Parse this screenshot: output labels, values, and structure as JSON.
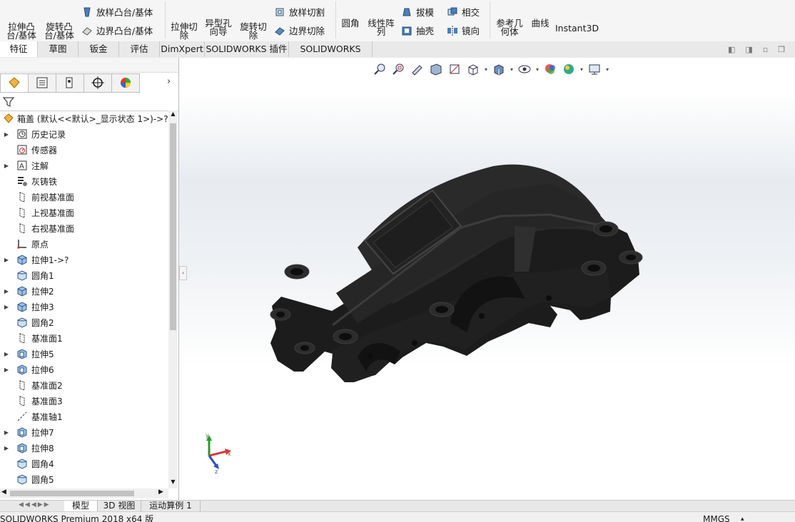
{
  "ribbon": {
    "extrude_boss": "拉伸凸\n台/基体",
    "revolve_boss": "旋转凸\n台/基体",
    "loft_boss": "放样凸台/基体",
    "boundary_boss": "边界凸台/基体",
    "extrude_cut": "拉伸切\n除",
    "hole_wizard": "异型孔\n向导",
    "revolve_cut": "旋转切\n除",
    "loft_cut": "放样切割",
    "boundary_cut": "边界切除",
    "fillet": "圆角",
    "linear_pattern": "线性阵\n列",
    "draft": "拔模",
    "shell": "抽壳",
    "intersect": "相交",
    "mirror": "镜向",
    "ref_geometry": "参考几\n何体",
    "curves": "曲线",
    "instant3d": "Instant3D"
  },
  "tabs": [
    "特征",
    "草图",
    "钣金",
    "评估",
    "DimXpert",
    "SOLIDWORKS 插件",
    "SOLIDWORKS MBD"
  ],
  "tree": {
    "root": "箱盖 (默认<<默认>_显示状态 1>)->?",
    "items": [
      {
        "label": "历史记录",
        "icon": "history-icon",
        "expand": true
      },
      {
        "label": "传感器",
        "icon": "sensor-icon",
        "expand": false
      },
      {
        "label": "注解",
        "icon": "annotation-icon",
        "expand": true
      },
      {
        "label": "灰铸铁",
        "icon": "material-icon",
        "expand": false
      },
      {
        "label": "前视基准面",
        "icon": "plane-icon",
        "expand": false
      },
      {
        "label": "上视基准面",
        "icon": "plane-icon",
        "expand": false
      },
      {
        "label": "右视基准面",
        "icon": "plane-icon",
        "expand": false
      },
      {
        "label": "原点",
        "icon": "origin-icon",
        "expand": false
      },
      {
        "label": "拉伸1->?",
        "icon": "extrude-icon",
        "expand": true
      },
      {
        "label": "圆角1",
        "icon": "fillet-icon",
        "expand": false
      },
      {
        "label": "拉伸2",
        "icon": "extrude-icon",
        "expand": true
      },
      {
        "label": "拉伸3",
        "icon": "extrude-icon",
        "expand": true
      },
      {
        "label": "圆角2",
        "icon": "fillet-icon",
        "expand": false
      },
      {
        "label": "基准面1",
        "icon": "plane-icon",
        "expand": false
      },
      {
        "label": "拉伸5",
        "icon": "cut-extrude-icon",
        "expand": true
      },
      {
        "label": "拉伸6",
        "icon": "cut-extrude-icon",
        "expand": true
      },
      {
        "label": "基准面2",
        "icon": "plane-icon",
        "expand": false
      },
      {
        "label": "基准面3",
        "icon": "plane-icon",
        "expand": false
      },
      {
        "label": "基准轴1",
        "icon": "axis-icon",
        "expand": false
      },
      {
        "label": "拉伸7",
        "icon": "cut-extrude-icon",
        "expand": true
      },
      {
        "label": "拉伸8",
        "icon": "cut-extrude-icon",
        "expand": true
      },
      {
        "label": "圆角4",
        "icon": "fillet-icon",
        "expand": false
      },
      {
        "label": "圆角5",
        "icon": "fillet-icon",
        "expand": false
      }
    ]
  },
  "bottom_tabs": [
    "模型",
    "3D 视图",
    "运动算例 1"
  ],
  "status": {
    "left": "SOLIDWORKS Premium 2018 x64 版",
    "units": "MMGS"
  },
  "triad": {
    "x": "x",
    "y": "y",
    "z": "z"
  },
  "colors": {
    "accent": "#0a5aa8",
    "part": "#1e1e1e"
  }
}
